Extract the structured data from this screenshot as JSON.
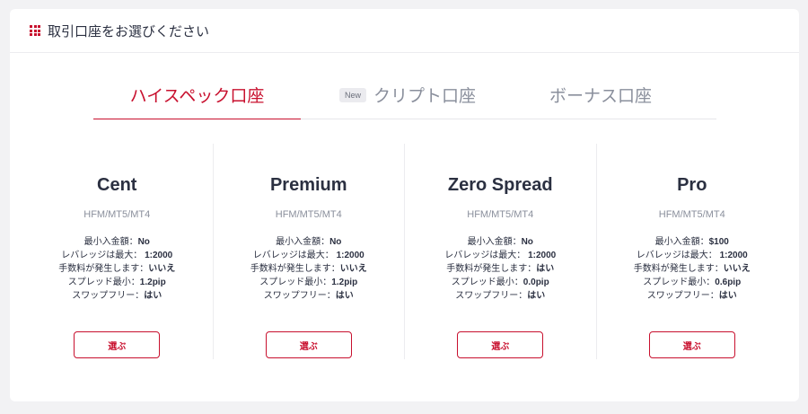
{
  "header": {
    "title": "取引口座をお選びください",
    "accent_color": "#c8102e"
  },
  "tabs": [
    {
      "label": "ハイスペック口座",
      "active": true
    },
    {
      "label": "クリプト口座",
      "badge": "New",
      "active": false
    },
    {
      "label": "ボーナス口座",
      "active": false
    }
  ],
  "plans": [
    {
      "name": "Cent",
      "platform": "HFM/MT5/MT4",
      "specs": [
        {
          "label": "最小入金額：",
          "value": "No"
        },
        {
          "label": "レバレッジは最大： ",
          "value": "1:2000"
        },
        {
          "label": "手数料が発生します：",
          "value": "いいえ"
        },
        {
          "label": "スプレッド最小：",
          "value": "1.2pip"
        },
        {
          "label": "スワップフリー：",
          "value": "はい"
        }
      ],
      "button": "選ぶ"
    },
    {
      "name": "Premium",
      "platform": "HFM/MT5/MT4",
      "specs": [
        {
          "label": "最小入金額：",
          "value": "No"
        },
        {
          "label": "レバレッジは最大： ",
          "value": "1:2000"
        },
        {
          "label": "手数料が発生します：",
          "value": "いいえ"
        },
        {
          "label": "スプレッド最小：",
          "value": "1.2pip"
        },
        {
          "label": "スワップフリー：",
          "value": "はい"
        }
      ],
      "button": "選ぶ"
    },
    {
      "name": "Zero Spread",
      "platform": "HFM/MT5/MT4",
      "specs": [
        {
          "label": "最小入金額：",
          "value": "No"
        },
        {
          "label": "レバレッジは最大： ",
          "value": "1:2000"
        },
        {
          "label": "手数料が発生します：",
          "value": "はい"
        },
        {
          "label": "スプレッド最小：",
          "value": "0.0pip"
        },
        {
          "label": "スワップフリー：",
          "value": "はい"
        }
      ],
      "button": "選ぶ"
    },
    {
      "name": "Pro",
      "platform": "HFM/MT5/MT4",
      "specs": [
        {
          "label": "最小入金額：",
          "value": "$100"
        },
        {
          "label": "レバレッジは最大： ",
          "value": "1:2000"
        },
        {
          "label": "手数料が発生します：",
          "value": "いいえ"
        },
        {
          "label": "スプレッド最小：",
          "value": "0.6pip"
        },
        {
          "label": "スワップフリー：",
          "value": "はい"
        }
      ],
      "button": "選ぶ"
    }
  ]
}
